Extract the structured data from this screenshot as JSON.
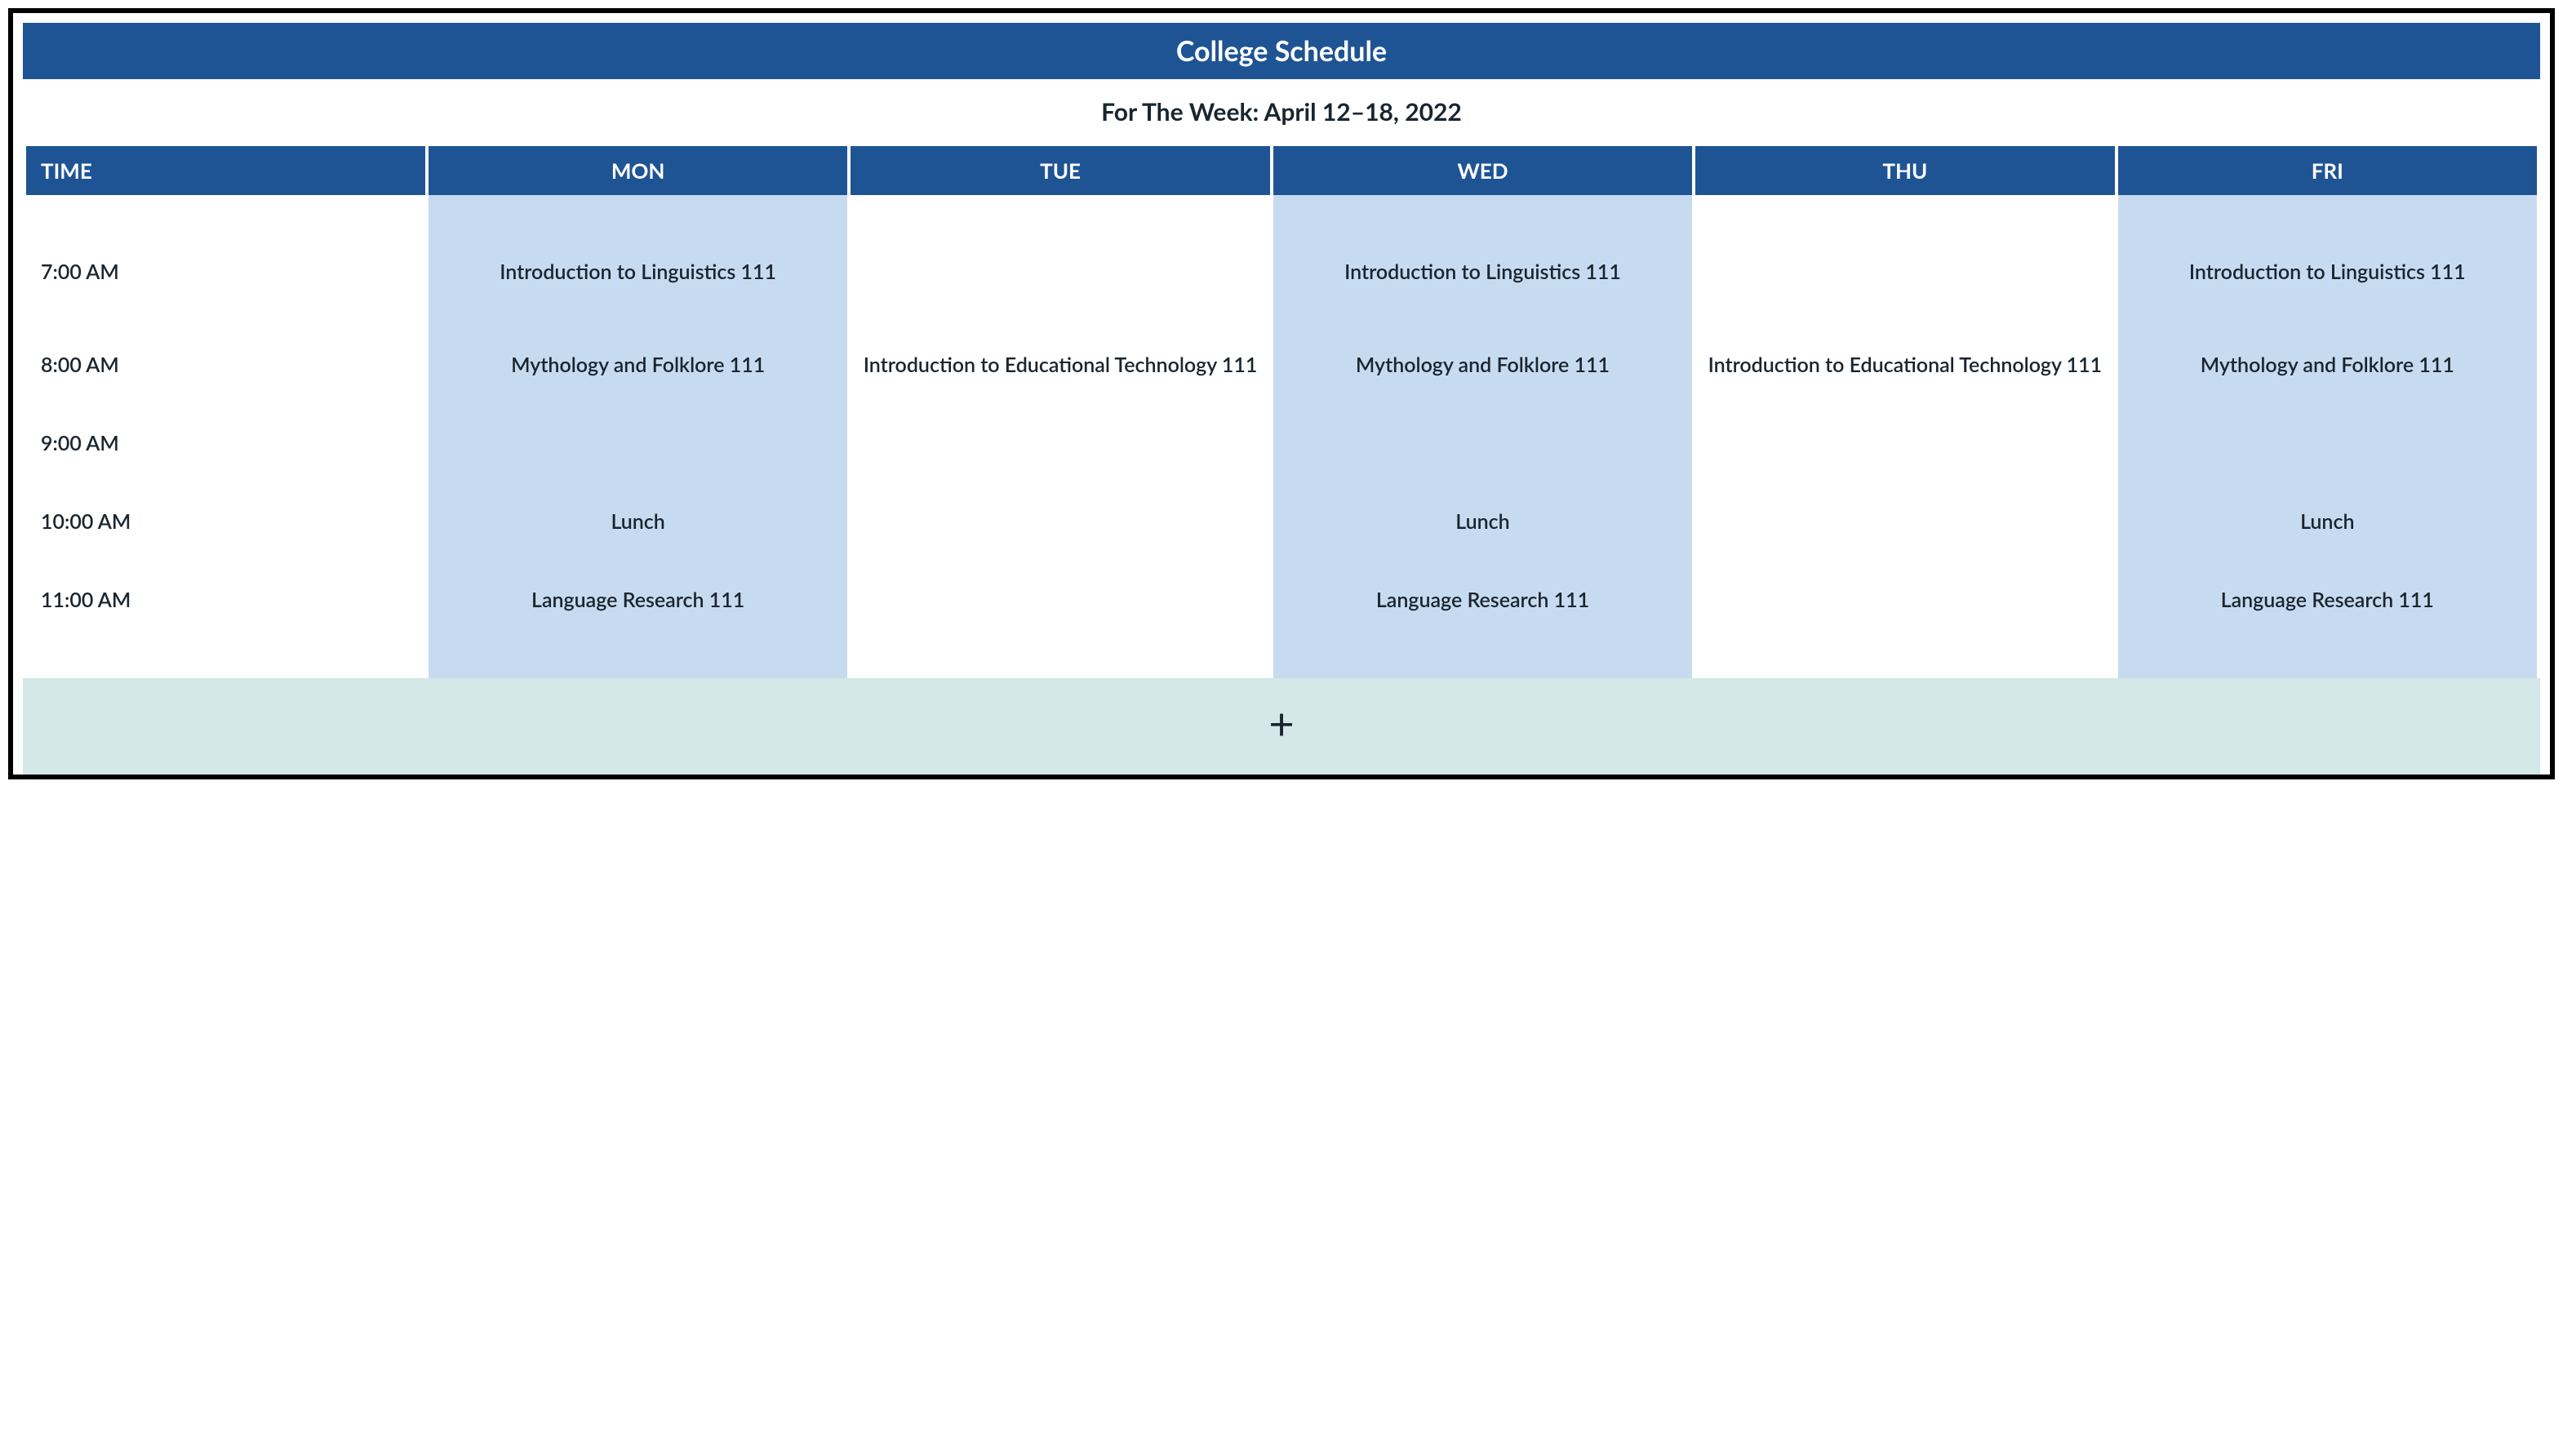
{
  "title": "College Schedule",
  "subtitle": "For The Week: April 12–18, 2022",
  "columns": {
    "time": "TIME",
    "days": [
      "MON",
      "TUE",
      "WED",
      "THU",
      "FRI"
    ]
  },
  "times": [
    "7:00 AM",
    "8:00 AM",
    "9:00 AM",
    "10:00 AM",
    "11:00 AM"
  ],
  "cells": {
    "mon": {
      "7": "Introduction to Linguistics 111",
      "8": "Mythology and Folklore 111",
      "9": "",
      "10": "Lunch",
      "11": "Language Research 111"
    },
    "tue": {
      "7": "",
      "8": "Introduction to Educational Technology 111",
      "9": "",
      "10": "",
      "11": ""
    },
    "wed": {
      "7": "Introduction to Linguistics 111",
      "8": "Mythology and Folklore 111",
      "9": "",
      "10": "Lunch",
      "11": "Language Research 111"
    },
    "thu": {
      "7": "",
      "8": "Introduction to Educational Technology 111",
      "9": "",
      "10": "",
      "11": ""
    },
    "fri": {
      "7": "Introduction to Linguistics 111",
      "8": "Mythology and Folklore 111",
      "9": "",
      "10": "Lunch",
      "11": "Language Research 111"
    }
  },
  "add_icon": "+",
  "colors": {
    "header_bg": "#1f5494",
    "shade_bg": "#c7dbf0",
    "add_bg": "#d4e8e8"
  }
}
